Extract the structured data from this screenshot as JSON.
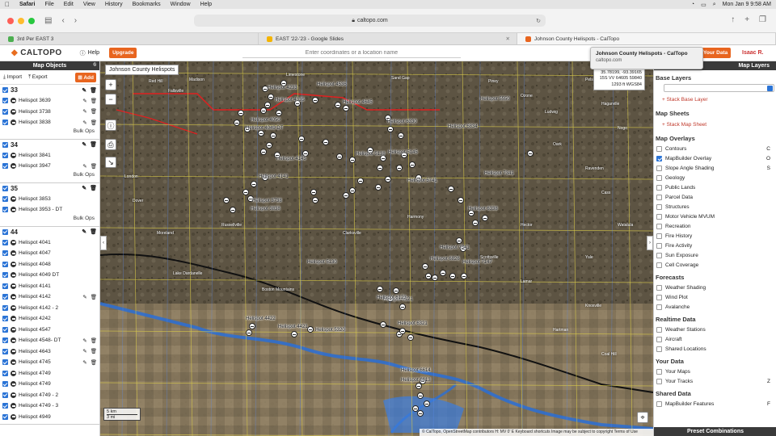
{
  "menubar": {
    "app": "Safari",
    "items": [
      "File",
      "Edit",
      "View",
      "History",
      "Bookmarks",
      "Window",
      "Help"
    ],
    "clock": "Mon Jan 9  9:58 AM"
  },
  "browser": {
    "url": "caltopo.com",
    "tabs": [
      {
        "label": "3rd Per EAST 3",
        "color": "#4caf50"
      },
      {
        "label": "EAST '22-'23 - Google Slides",
        "color": "#f4b400"
      },
      {
        "label": "Johnson County Helispots - CalTopo",
        "color": "#e8651f"
      }
    ]
  },
  "tooltip": {
    "title": "Johnson County Helispots - CalTopo",
    "url": "caltopo.com"
  },
  "header": {
    "logo": "CALTOPO",
    "help": "Help",
    "upgrade": "Upgrade",
    "search_placeholder": "Enter coordinates or a location name",
    "your_data": "Your Data",
    "user": "Isaac R."
  },
  "left_panel": {
    "title": "Map Objects",
    "import": "Import",
    "export": "Export",
    "add": "Add",
    "bulk_label": "Bulk Ops",
    "groups": [
      {
        "name": "33",
        "items": [
          {
            "label": "Helispot 3639",
            "edit": true
          },
          {
            "label": "Helispot 3738",
            "edit": true
          },
          {
            "label": "Helispot 3838",
            "edit": true
          }
        ],
        "bulk": true
      },
      {
        "name": "34",
        "items": [
          {
            "label": "Helispot 3841",
            "edit": false
          },
          {
            "label": "Helispot 3947",
            "edit": true
          }
        ],
        "bulk": true
      },
      {
        "name": "35",
        "items": [
          {
            "label": "Helispot 3853",
            "edit": false
          },
          {
            "label": "Helispot 3953 - DT",
            "edit": false
          }
        ],
        "bulk": true
      },
      {
        "name": "44",
        "items": [
          {
            "label": "Helispot 4041",
            "edit": false
          },
          {
            "label": "Helispot 4047",
            "edit": false
          },
          {
            "label": "Helispot 4048",
            "edit": false
          },
          {
            "label": "Helispot 4049 DT",
            "edit": false
          },
          {
            "label": "Helispot 4141",
            "edit": false
          },
          {
            "label": "Helispot 4142",
            "edit": true
          },
          {
            "label": "Helispot 4142 - 2",
            "edit": false
          },
          {
            "label": "Helispot 4242",
            "edit": false
          },
          {
            "label": "Helispot 4547",
            "edit": false
          },
          {
            "label": "Helispot 4548- DT",
            "edit": true
          },
          {
            "label": "Helispot 4643",
            "edit": true
          },
          {
            "label": "Helispot 4745",
            "edit": true
          },
          {
            "label": "Helispot 4749",
            "edit": false
          },
          {
            "label": "Helispot 4749",
            "edit": false
          },
          {
            "label": "Helispot 4749 - 2",
            "edit": false
          },
          {
            "label": "Helispot 4749 - 3",
            "edit": false
          },
          {
            "label": "Helispot 4949",
            "edit": false
          }
        ],
        "bulk": false
      }
    ]
  },
  "map": {
    "title": "Johnson County Helispots",
    "coords": [
      "35.78199, -93.39165",
      "15S VV 64605 59840",
      "1293 ft    WGS84"
    ],
    "scale": [
      "5 km",
      "3 mi"
    ],
    "attribution": "© CalTopo, OpenStreetMap contributors  H: MV 0' E   Keyboard shortcuts   Image may be subject to copyright   Terms of Use",
    "helispot_labels": [
      "Helispot 4050",
      "Helispot 4049 DT",
      "Helispot 4145",
      "Helispot 4141",
      "Helispot 3738",
      "Helispot 3838",
      "Helispot 4233",
      "Helispot 4335",
      "Helispot 4536",
      "Helispot 4645",
      "Helispot 5138",
      "Helispot 5145",
      "Helispot 5741",
      "Helispot 7341",
      "Helispot 6330",
      "Helispot 6834",
      "Helispot 5130",
      "Helispot 6121",
      "Helispot 6123",
      "Helispot 4422",
      "Helispot 4421",
      "Helispot 6321",
      "Helispot 6614",
      "Helispot 6613",
      "Helispot 5320",
      "Helispot 6826",
      "Helispot 7341",
      "Helispot 7147",
      "Helispot 5550",
      "Helispot 6338"
    ],
    "places": [
      "Madison",
      "Red Hill",
      "Fallsville",
      "Limestone",
      "Sand Gap",
      "Piney",
      "Ozone",
      "Ludwig",
      "Pelsor",
      "Hagarville",
      "Oark",
      "Ravenden",
      "Cass",
      "Watalula",
      "Yale",
      "Lamar",
      "Knoxville",
      "Hartman",
      "Coal Hill",
      "London",
      "Dover",
      "Moreland",
      "Lake Dardanelle",
      "Russellville",
      "Clarksville",
      "Harmony",
      "Scottsville",
      "Hector",
      "Nogo",
      "Boston Mountains"
    ],
    "marker_count": 60
  },
  "right_panel": {
    "title": "Map Layers",
    "base_layers": "Base Layers",
    "stack_base": "+ Stack Base Layer",
    "map_sheets": "Map Sheets",
    "stack_sheet": "+ Stack Map Sheet",
    "overlays_title": "Map Overlays",
    "overlays": [
      {
        "label": "Contours",
        "on": false,
        "key": "C"
      },
      {
        "label": "MapBuilder Overlay",
        "on": true,
        "key": "O"
      },
      {
        "label": "Slope Angle Shading",
        "on": false,
        "key": "S"
      },
      {
        "label": "Geology",
        "on": false,
        "key": ""
      },
      {
        "label": "Public Lands",
        "on": false,
        "key": ""
      },
      {
        "label": "Parcel Data",
        "on": false,
        "key": ""
      },
      {
        "label": "Structures",
        "on": false,
        "key": ""
      },
      {
        "label": "Motor Vehicle MVUM",
        "on": false,
        "key": ""
      },
      {
        "label": "Recreation",
        "on": false,
        "key": ""
      },
      {
        "label": "Fire History",
        "on": false,
        "key": ""
      },
      {
        "label": "Fire Activity",
        "on": false,
        "key": ""
      },
      {
        "label": "Sun Exposure",
        "on": false,
        "key": ""
      },
      {
        "label": "Cell Coverage",
        "on": false,
        "key": ""
      }
    ],
    "forecasts_title": "Forecasts",
    "forecasts": [
      {
        "label": "Weather Shading",
        "on": false,
        "key": ""
      },
      {
        "label": "Wind Plot",
        "on": false,
        "key": ""
      },
      {
        "label": "Avalanche",
        "on": false,
        "key": ""
      }
    ],
    "realtime_title": "Realtime Data",
    "realtime": [
      {
        "label": "Weather Stations",
        "on": false,
        "key": ""
      },
      {
        "label": "Aircraft",
        "on": false,
        "key": ""
      },
      {
        "label": "Shared Locations",
        "on": false,
        "key": ""
      }
    ],
    "yourdata_title": "Your Data",
    "yourdata": [
      {
        "label": "Your Maps",
        "on": false,
        "key": ""
      },
      {
        "label": "Your Tracks",
        "on": false,
        "key": "Z"
      }
    ],
    "shared_title": "Shared Data",
    "shared": [
      {
        "label": "MapBuilder Features",
        "on": false,
        "key": "F"
      }
    ],
    "preset": "Preset Combinations"
  }
}
